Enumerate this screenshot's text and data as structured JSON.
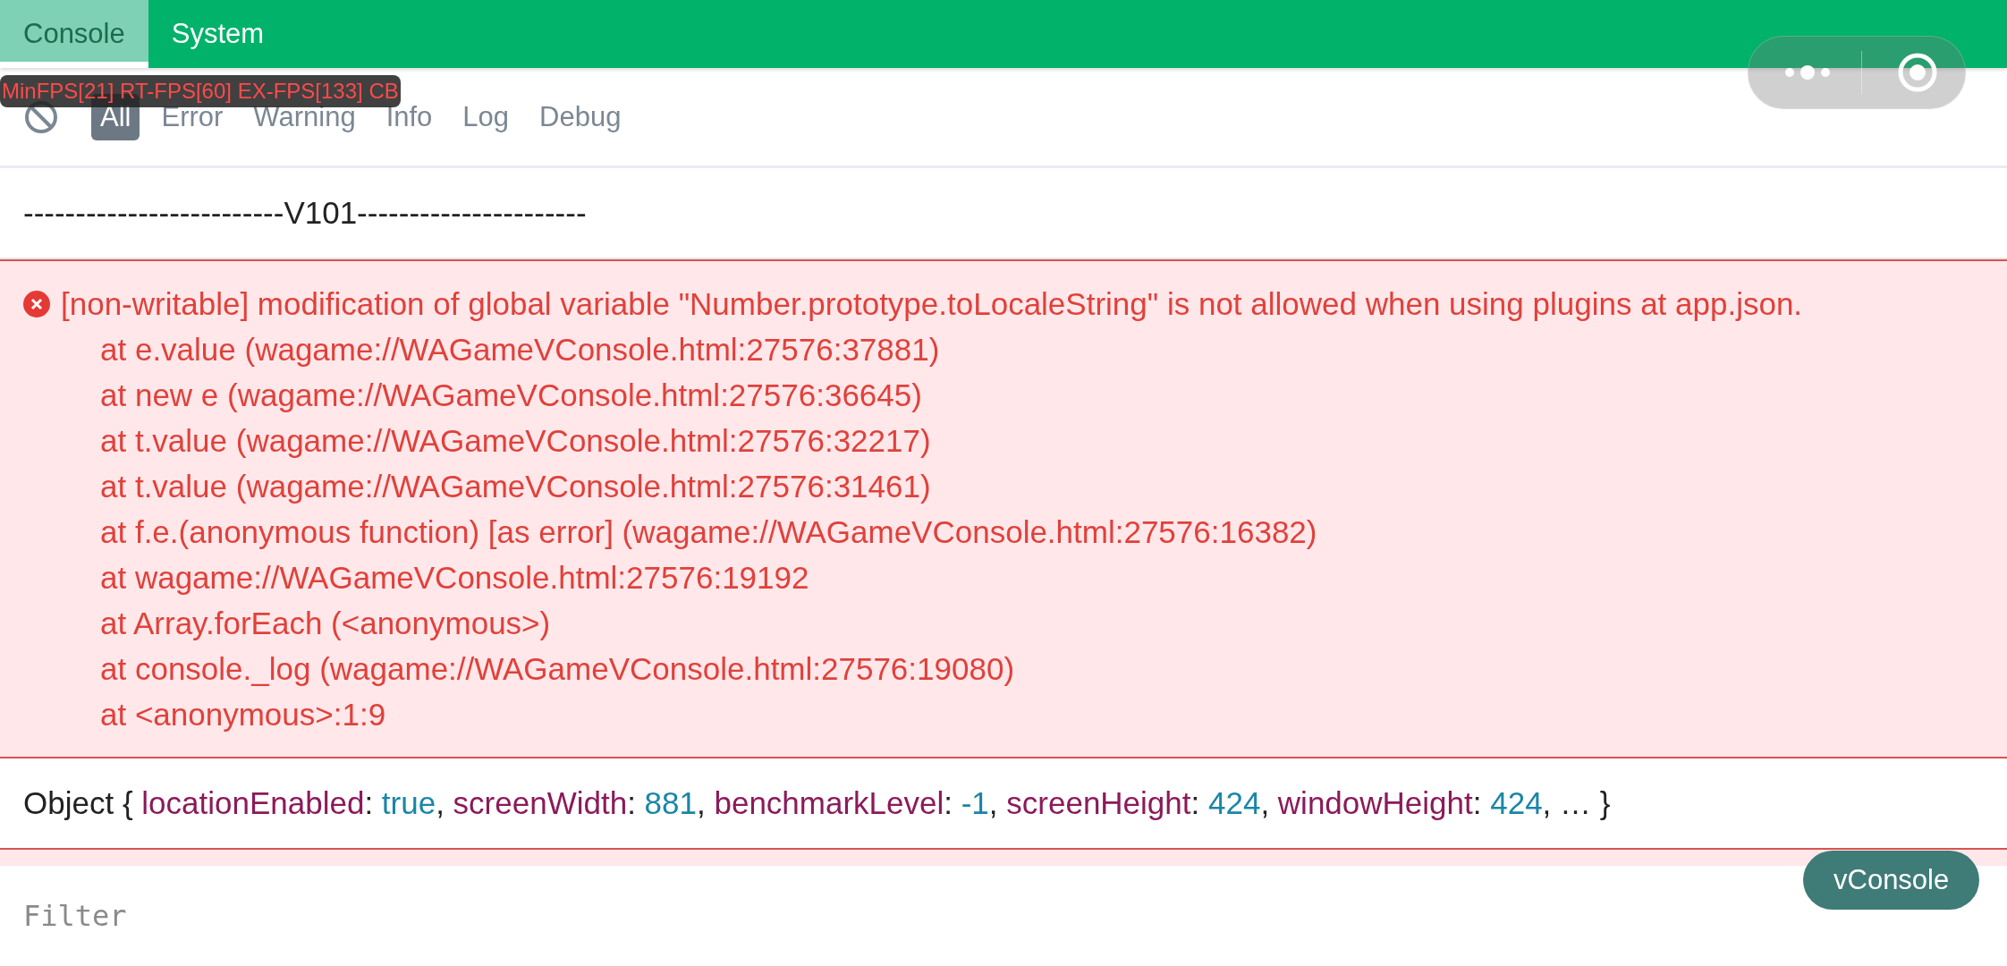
{
  "tabs": [
    {
      "label": "Console",
      "selected": true
    },
    {
      "label": "System",
      "selected": false
    }
  ],
  "fps_overlay": "MinFPS[21] RT-FPS[60] EX-FPS[133] CB",
  "filters": [
    {
      "label": "All",
      "selected": true
    },
    {
      "label": "Error",
      "selected": false
    },
    {
      "label": "Warning",
      "selected": false
    },
    {
      "label": "Info",
      "selected": false
    },
    {
      "label": "Log",
      "selected": false
    },
    {
      "label": "Debug",
      "selected": false
    }
  ],
  "logs": [
    {
      "kind": "log",
      "message": "-------------------------V101----------------------"
    },
    {
      "kind": "error",
      "message": "[non-writable] modification of global variable \"Number.prototype.toLocaleString\" is not allowed when using plugins at app.json.",
      "stack": [
        "at e.value (wagame://WAGameVConsole.html:27576:37881)",
        "at new e (wagame://WAGameVConsole.html:27576:36645)",
        "at t.value (wagame://WAGameVConsole.html:27576:32217)",
        "at t.value (wagame://WAGameVConsole.html:27576:31461)",
        "at f.e.(anonymous function) [as error] (wagame://WAGameVConsole.html:27576:16382)",
        "at wagame://WAGameVConsole.html:27576:19192",
        "at Array.forEach (<anonymous>)",
        "at console._log (wagame://WAGameVConsole.html:27576:19080)",
        "at <anonymous>:1:9"
      ]
    },
    {
      "kind": "object",
      "segments": [
        {
          "kind": "plain",
          "text": "Object { "
        },
        {
          "kind": "key",
          "text": "locationEnabled"
        },
        {
          "kind": "plain",
          "text": ": "
        },
        {
          "kind": "value",
          "text": "true"
        },
        {
          "kind": "plain",
          "text": ", "
        },
        {
          "kind": "key",
          "text": "screenWidth"
        },
        {
          "kind": "plain",
          "text": ": "
        },
        {
          "kind": "value",
          "text": "881"
        },
        {
          "kind": "plain",
          "text": ", "
        },
        {
          "kind": "key",
          "text": "benchmarkLevel"
        },
        {
          "kind": "plain",
          "text": ": "
        },
        {
          "kind": "value",
          "text": "-1"
        },
        {
          "kind": "plain",
          "text": ", "
        },
        {
          "kind": "key",
          "text": "screenHeight"
        },
        {
          "kind": "plain",
          "text": ": "
        },
        {
          "kind": "value",
          "text": "424"
        },
        {
          "kind": "plain",
          "text": ", "
        },
        {
          "kind": "key",
          "text": "windowHeight"
        },
        {
          "kind": "plain",
          "text": ": "
        },
        {
          "kind": "value",
          "text": "424"
        },
        {
          "kind": "plain",
          "text": ", … }"
        }
      ]
    }
  ],
  "filter_input": {
    "placeholder": "Filter"
  },
  "toggle_button": "vConsole"
}
